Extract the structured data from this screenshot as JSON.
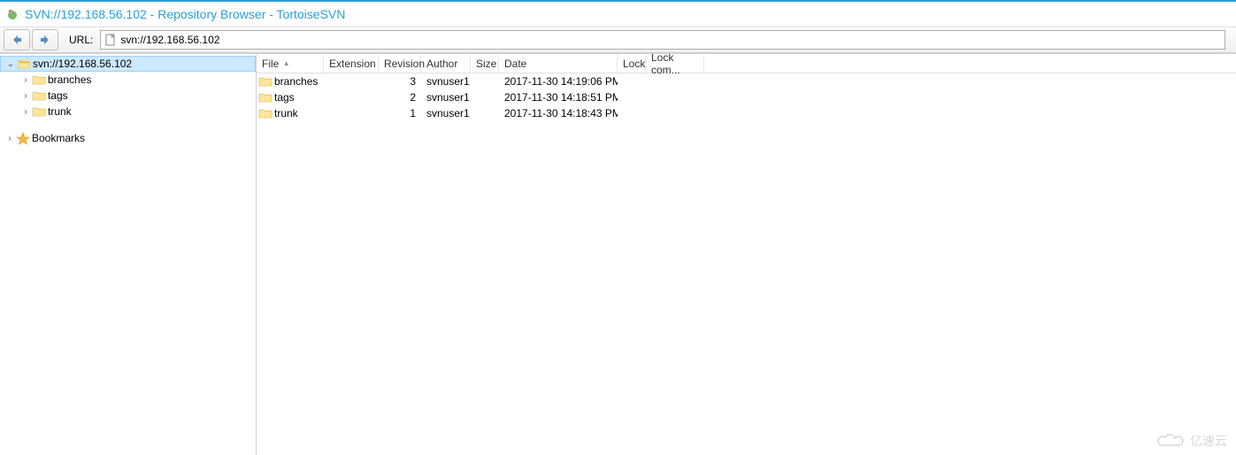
{
  "window": {
    "title": "SVN://192.168.56.102 - Repository Browser - TortoiseSVN"
  },
  "toolbar": {
    "url_label": "URL:",
    "url_value": "svn://192.168.56.102"
  },
  "tree": {
    "root": {
      "label": "svn://192.168.56.102",
      "expanded": true
    },
    "children": [
      {
        "label": "branches"
      },
      {
        "label": "tags"
      },
      {
        "label": "trunk"
      }
    ],
    "bookmarks": {
      "label": "Bookmarks"
    }
  },
  "list": {
    "columns": {
      "file": "File",
      "extension": "Extension",
      "revision": "Revision",
      "author": "Author",
      "size": "Size",
      "date": "Date",
      "lock": "Lock",
      "lock_comment": "Lock com..."
    },
    "sort_indicator": "▴",
    "rows": [
      {
        "file": "branches",
        "extension": "",
        "revision": "3",
        "author": "svnuser1",
        "size": "",
        "date": "2017-11-30 14:19:06 PM",
        "lock": "",
        "lock_comment": ""
      },
      {
        "file": "tags",
        "extension": "",
        "revision": "2",
        "author": "svnuser1",
        "size": "",
        "date": "2017-11-30 14:18:51 PM",
        "lock": "",
        "lock_comment": ""
      },
      {
        "file": "trunk",
        "extension": "",
        "revision": "1",
        "author": "svnuser1",
        "size": "",
        "date": "2017-11-30 14:18:43 PM",
        "lock": "",
        "lock_comment": ""
      }
    ]
  },
  "watermark": {
    "text": "亿速云"
  }
}
